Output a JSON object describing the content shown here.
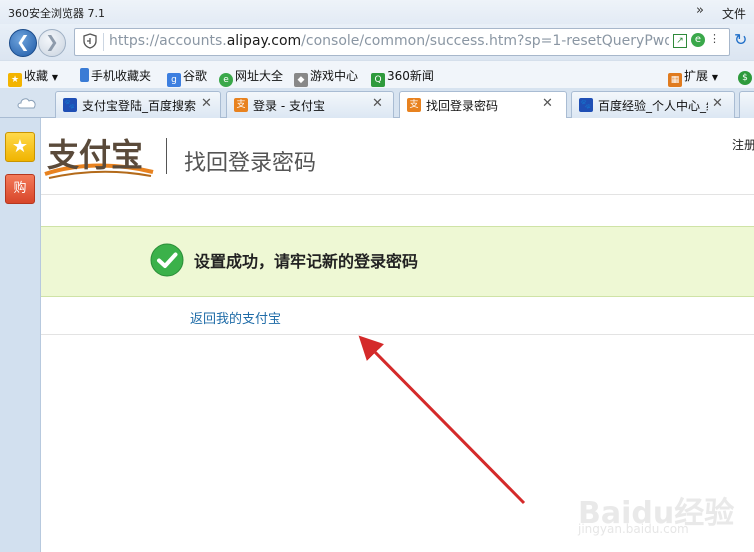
{
  "window": {
    "title": "360安全浏览器 7.1",
    "menu_chevron": "»",
    "menu_file": "文件"
  },
  "address_bar": {
    "url_prefix": "https://accounts.",
    "url_domain": "alipay.com",
    "url_suffix": "/console/common/success.htm?sp=1-resetQueryPwd-full"
  },
  "bookmarks": [
    {
      "label": "收藏",
      "icon": "favorites-icon"
    },
    {
      "label": "手机收藏夹",
      "icon": "phone-icon"
    },
    {
      "label": "谷歌",
      "icon": "google-icon"
    },
    {
      "label": "网址大全",
      "icon": "directory-icon"
    },
    {
      "label": "游戏中心",
      "icon": "gamepad-icon"
    },
    {
      "label": "360新闻",
      "icon": "news-icon"
    },
    {
      "label": "扩展",
      "icon": "extensions-icon"
    }
  ],
  "tabs": [
    {
      "label": "支付宝登陆_百度搜索",
      "icon": "baidu-paw-icon",
      "active": false
    },
    {
      "label": "登录 - 支付宝",
      "icon": "alipay-icon",
      "active": false
    },
    {
      "label": "找回登录密码",
      "icon": "alipay-icon",
      "active": true
    },
    {
      "label": "百度经验_个人中心_经",
      "icon": "baidu-paw-icon",
      "active": false
    }
  ],
  "page": {
    "logo_text": "支付宝",
    "title": "找回登录密码",
    "register_link": "注册",
    "success_message": "设置成功，请牢记新的登录密码",
    "back_link": "返回我的支付宝"
  },
  "sidebar": {
    "shop_label": "购"
  },
  "watermark": {
    "brand": "Baidu经验",
    "url": "jingyan.baidu.com"
  },
  "colors": {
    "accent_link": "#1f6ca8",
    "success_bg": "#eef8d4",
    "arrow": "#d42a2a"
  }
}
